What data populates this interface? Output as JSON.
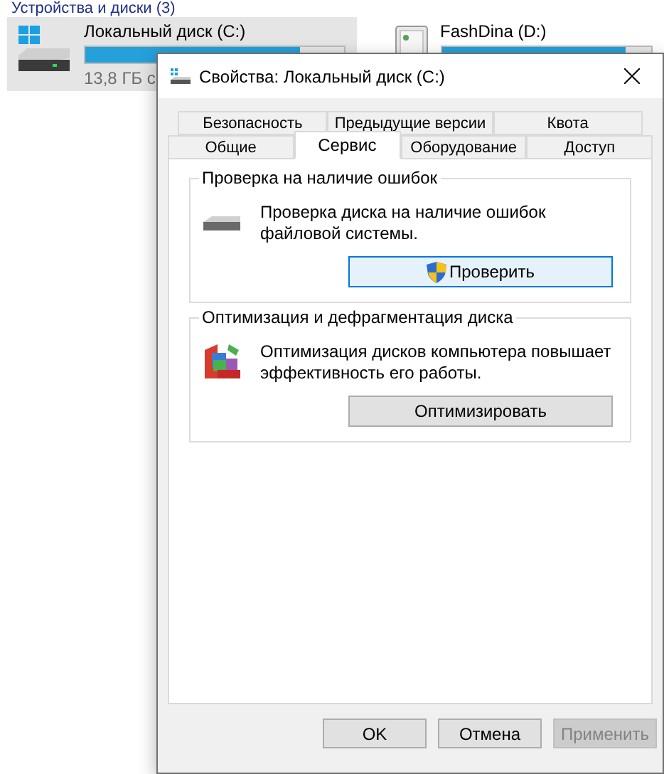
{
  "explorer": {
    "section_title": "Устройства и диски (3)",
    "drives": [
      {
        "name": "Локальный диск (C:)",
        "kind": "system",
        "selected": true,
        "level": 0.83,
        "free": "13,8 ГБ с"
      },
      {
        "name": "FashDina (D:)",
        "kind": "removable",
        "selected": false,
        "level": 0.88
      }
    ]
  },
  "dialog": {
    "title": "Свойства: Локальный диск (C:)",
    "tab_rows": [
      [
        {
          "label": "Безопасность",
          "selected": false
        },
        {
          "label": "Предыдущие версии",
          "selected": false
        },
        {
          "label": "Квота",
          "selected": false
        }
      ],
      [
        {
          "label": "Общие",
          "selected": false
        },
        {
          "label": "Сервис",
          "selected": true
        },
        {
          "label": "Оборудование",
          "selected": false
        },
        {
          "label": "Доступ",
          "selected": false
        }
      ]
    ],
    "groups": [
      {
        "title": "Проверка на наличие ошибок",
        "kind": "check",
        "text": "Проверка диска на наличие ошибок файловой системы.",
        "button": {
          "label": "Проверить",
          "shield": true,
          "focused": true
        }
      },
      {
        "title": "Оптимизация и дефрагментация диска",
        "kind": "defrag",
        "text": "Оптимизация дисков компьютера повышает эффективность его работы.",
        "button": {
          "label": "Оптимизировать",
          "shield": false,
          "focused": false
        }
      }
    ],
    "buttons": [
      {
        "label": "OK",
        "disabled": false
      },
      {
        "label": "Отмена",
        "disabled": false
      },
      {
        "label": "Применить",
        "disabled": true
      }
    ]
  }
}
